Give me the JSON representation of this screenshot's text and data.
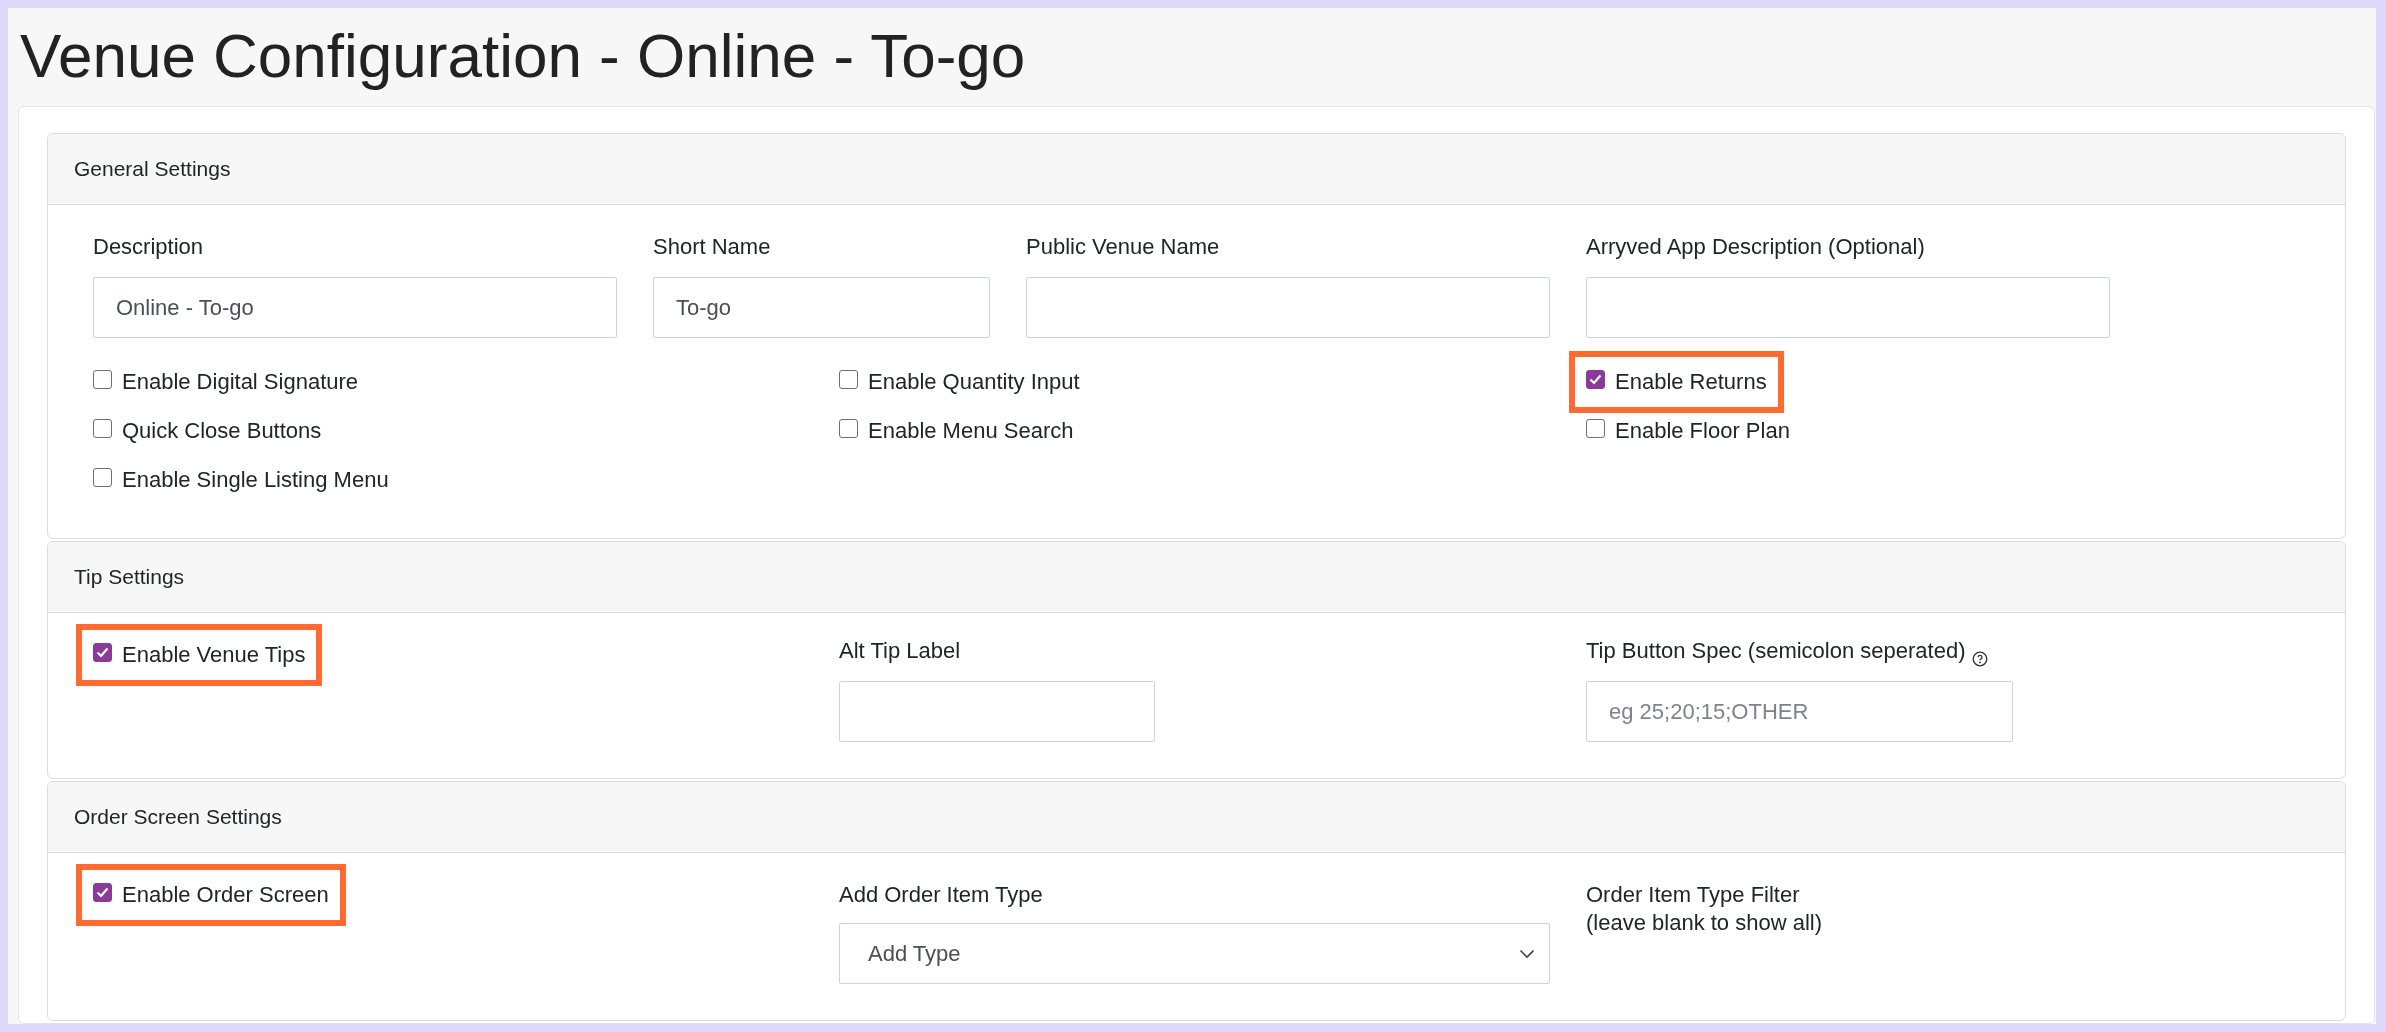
{
  "page": {
    "title": "Venue Configuration - Online - To-go"
  },
  "general": {
    "title": "General Settings",
    "fields": [
      {
        "label": "Description",
        "value": "Online - To-go"
      },
      {
        "label": "Short Name",
        "value": "To-go"
      },
      {
        "label": "Public Venue Name"
      },
      {
        "label": "Arryved App Description (Optional)"
      }
    ],
    "checkbox_columns": [
      [
        {
          "label": "Enable Digital Signature",
          "checked": false,
          "highlighted": false
        },
        {
          "label": "Quick Close Buttons",
          "checked": false,
          "highlighted": false
        },
        {
          "label": "Enable Single Listing Menu",
          "checked": false,
          "highlighted": false
        }
      ],
      [
        {
          "label": "Enable Quantity Input",
          "checked": false,
          "highlighted": false
        },
        {
          "label": "Enable Menu Search",
          "checked": false,
          "highlighted": false
        }
      ],
      [
        {
          "label": "Enable Returns",
          "checked": true,
          "highlighted": true
        },
        {
          "label": "Enable Floor Plan",
          "checked": false,
          "highlighted": false
        }
      ]
    ]
  },
  "sections": [
    {
      "title": "Tip Settings",
      "columns": [
        {
          "kind": "checkbox",
          "label": "Enable Venue Tips",
          "checked": true,
          "highlighted": true
        },
        {
          "kind": "text",
          "label": "Alt Tip Label"
        },
        {
          "kind": "text",
          "label": "Tip Button Spec (semicolon seperated)",
          "help_icon": true,
          "placeholder": "eg 25;20;15;OTHER"
        }
      ]
    },
    {
      "title": "Order Screen Settings",
      "columns": [
        {
          "kind": "checkbox",
          "label": "Enable Order Screen",
          "checked": true,
          "highlighted": true
        },
        {
          "kind": "select",
          "label": "Add Order Item Type",
          "value": "Add Type"
        },
        {
          "kind": "note",
          "label": "Order Item Type Filter",
          "note": "(leave blank to show all)"
        }
      ]
    }
  ]
}
